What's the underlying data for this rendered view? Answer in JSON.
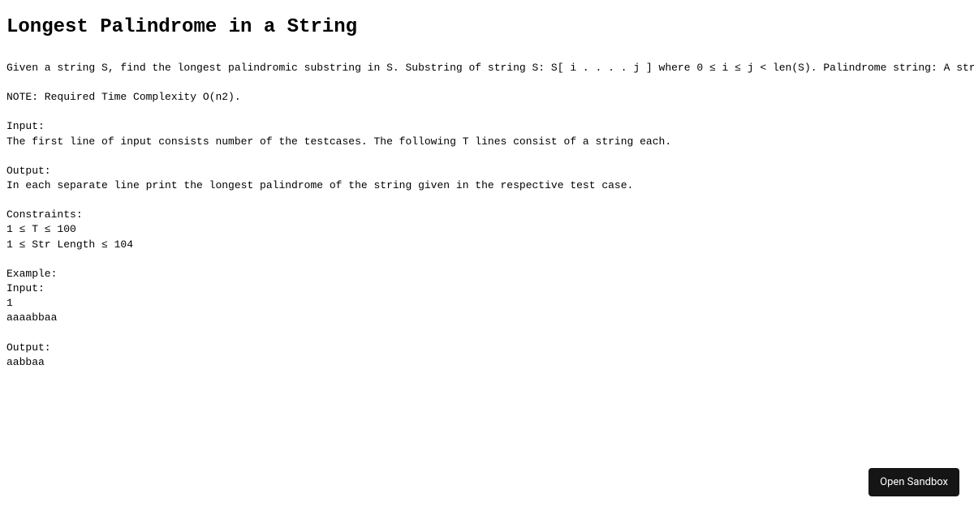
{
  "title": "Longest Palindrome in a String",
  "description": "Given a string S, find the longest palindromic substring in S. Substring of string S: S[ i . . . . j ] where 0 ≤ i ≤ j < len(S). Palindrome string: A str",
  "note": "NOTE: Required Time Complexity O(n2).",
  "input_section": "Input:\nThe first line of input consists number of the testcases. The following T lines consist of a string each.",
  "output_section": "Output:\nIn each separate line print the longest palindrome of the string given in the respective test case.",
  "constraints_section": "Constraints:\n1 ≤ T ≤ 100\n1 ≤ Str Length ≤ 104",
  "example_section": "Example:\nInput:\n1\naaaabbaa\n\nOutput:\naabbaa",
  "button_label": "Open Sandbox"
}
